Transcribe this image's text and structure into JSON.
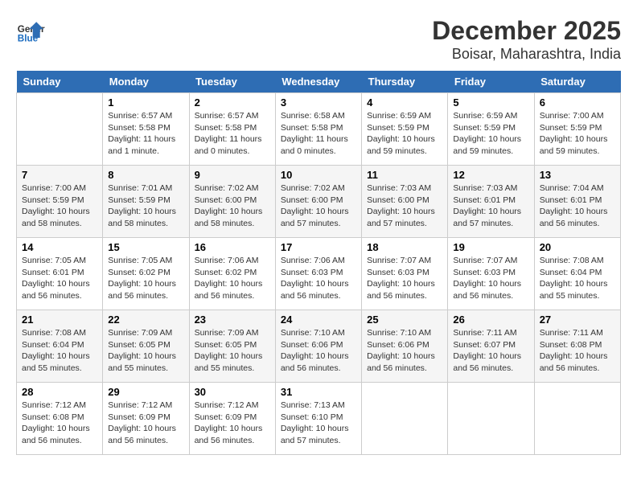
{
  "logo": {
    "text_general": "General",
    "text_blue": "Blue"
  },
  "title": "December 2025",
  "subtitle": "Boisar, Maharashtra, India",
  "days_of_week": [
    "Sunday",
    "Monday",
    "Tuesday",
    "Wednesday",
    "Thursday",
    "Friday",
    "Saturday"
  ],
  "weeks": [
    [
      {
        "day": "",
        "info": ""
      },
      {
        "day": "1",
        "info": "Sunrise: 6:57 AM\nSunset: 5:58 PM\nDaylight: 11 hours\nand 1 minute."
      },
      {
        "day": "2",
        "info": "Sunrise: 6:57 AM\nSunset: 5:58 PM\nDaylight: 11 hours\nand 0 minutes."
      },
      {
        "day": "3",
        "info": "Sunrise: 6:58 AM\nSunset: 5:58 PM\nDaylight: 11 hours\nand 0 minutes."
      },
      {
        "day": "4",
        "info": "Sunrise: 6:59 AM\nSunset: 5:59 PM\nDaylight: 10 hours\nand 59 minutes."
      },
      {
        "day": "5",
        "info": "Sunrise: 6:59 AM\nSunset: 5:59 PM\nDaylight: 10 hours\nand 59 minutes."
      },
      {
        "day": "6",
        "info": "Sunrise: 7:00 AM\nSunset: 5:59 PM\nDaylight: 10 hours\nand 59 minutes."
      }
    ],
    [
      {
        "day": "7",
        "info": "Sunrise: 7:00 AM\nSunset: 5:59 PM\nDaylight: 10 hours\nand 58 minutes."
      },
      {
        "day": "8",
        "info": "Sunrise: 7:01 AM\nSunset: 5:59 PM\nDaylight: 10 hours\nand 58 minutes."
      },
      {
        "day": "9",
        "info": "Sunrise: 7:02 AM\nSunset: 6:00 PM\nDaylight: 10 hours\nand 58 minutes."
      },
      {
        "day": "10",
        "info": "Sunrise: 7:02 AM\nSunset: 6:00 PM\nDaylight: 10 hours\nand 57 minutes."
      },
      {
        "day": "11",
        "info": "Sunrise: 7:03 AM\nSunset: 6:00 PM\nDaylight: 10 hours\nand 57 minutes."
      },
      {
        "day": "12",
        "info": "Sunrise: 7:03 AM\nSunset: 6:01 PM\nDaylight: 10 hours\nand 57 minutes."
      },
      {
        "day": "13",
        "info": "Sunrise: 7:04 AM\nSunset: 6:01 PM\nDaylight: 10 hours\nand 56 minutes."
      }
    ],
    [
      {
        "day": "14",
        "info": "Sunrise: 7:05 AM\nSunset: 6:01 PM\nDaylight: 10 hours\nand 56 minutes."
      },
      {
        "day": "15",
        "info": "Sunrise: 7:05 AM\nSunset: 6:02 PM\nDaylight: 10 hours\nand 56 minutes."
      },
      {
        "day": "16",
        "info": "Sunrise: 7:06 AM\nSunset: 6:02 PM\nDaylight: 10 hours\nand 56 minutes."
      },
      {
        "day": "17",
        "info": "Sunrise: 7:06 AM\nSunset: 6:03 PM\nDaylight: 10 hours\nand 56 minutes."
      },
      {
        "day": "18",
        "info": "Sunrise: 7:07 AM\nSunset: 6:03 PM\nDaylight: 10 hours\nand 56 minutes."
      },
      {
        "day": "19",
        "info": "Sunrise: 7:07 AM\nSunset: 6:03 PM\nDaylight: 10 hours\nand 56 minutes."
      },
      {
        "day": "20",
        "info": "Sunrise: 7:08 AM\nSunset: 6:04 PM\nDaylight: 10 hours\nand 55 minutes."
      }
    ],
    [
      {
        "day": "21",
        "info": "Sunrise: 7:08 AM\nSunset: 6:04 PM\nDaylight: 10 hours\nand 55 minutes."
      },
      {
        "day": "22",
        "info": "Sunrise: 7:09 AM\nSunset: 6:05 PM\nDaylight: 10 hours\nand 55 minutes."
      },
      {
        "day": "23",
        "info": "Sunrise: 7:09 AM\nSunset: 6:05 PM\nDaylight: 10 hours\nand 55 minutes."
      },
      {
        "day": "24",
        "info": "Sunrise: 7:10 AM\nSunset: 6:06 PM\nDaylight: 10 hours\nand 56 minutes."
      },
      {
        "day": "25",
        "info": "Sunrise: 7:10 AM\nSunset: 6:06 PM\nDaylight: 10 hours\nand 56 minutes."
      },
      {
        "day": "26",
        "info": "Sunrise: 7:11 AM\nSunset: 6:07 PM\nDaylight: 10 hours\nand 56 minutes."
      },
      {
        "day": "27",
        "info": "Sunrise: 7:11 AM\nSunset: 6:08 PM\nDaylight: 10 hours\nand 56 minutes."
      }
    ],
    [
      {
        "day": "28",
        "info": "Sunrise: 7:12 AM\nSunset: 6:08 PM\nDaylight: 10 hours\nand 56 minutes."
      },
      {
        "day": "29",
        "info": "Sunrise: 7:12 AM\nSunset: 6:09 PM\nDaylight: 10 hours\nand 56 minutes."
      },
      {
        "day": "30",
        "info": "Sunrise: 7:12 AM\nSunset: 6:09 PM\nDaylight: 10 hours\nand 56 minutes."
      },
      {
        "day": "31",
        "info": "Sunrise: 7:13 AM\nSunset: 6:10 PM\nDaylight: 10 hours\nand 57 minutes."
      },
      {
        "day": "",
        "info": ""
      },
      {
        "day": "",
        "info": ""
      },
      {
        "day": "",
        "info": ""
      }
    ]
  ]
}
